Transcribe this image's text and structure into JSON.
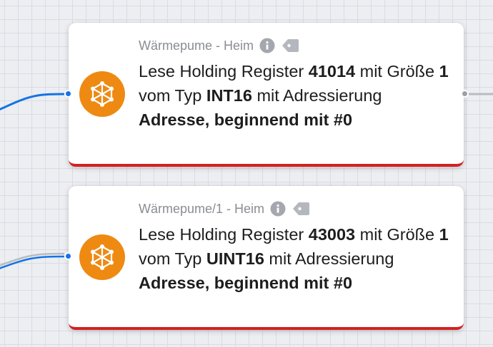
{
  "colors": {
    "accent": "#ee8a12",
    "wire": "#1473e6",
    "error_bar": "#d61f1f"
  },
  "nodes": [
    {
      "header": "Wärmepume - Heim",
      "icons": [
        "info-icon",
        "tag-icon"
      ],
      "node_icon": "hexagon-nodes-icon",
      "text": {
        "p1": "Lese Holding Register ",
        "register": "41014",
        "p2": " mit Größe ",
        "size": "1",
        "p3": " vom Typ ",
        "type": "INT16",
        "p4": " mit Adressierung ",
        "addressing": "Adresse, beginnend mit #0"
      }
    },
    {
      "header": "Wärmepume/1 - Heim",
      "icons": [
        "info-icon",
        "tag-icon"
      ],
      "node_icon": "hexagon-nodes-icon",
      "text": {
        "p1": "Lese Holding Register ",
        "register": "43003",
        "p2": " mit Größe ",
        "size": "1",
        "p3": " vom Typ ",
        "type": "UINT16",
        "p4": " mit Adressierung ",
        "addressing": "Adresse, beginnend mit #0"
      }
    }
  ]
}
